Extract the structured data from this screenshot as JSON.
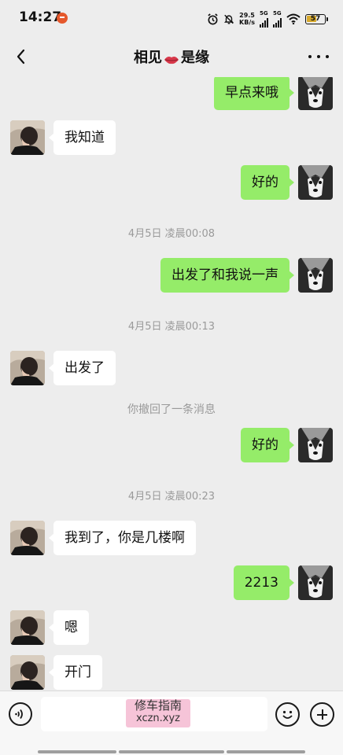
{
  "status_bar": {
    "time": "14:27",
    "net_speed_value": "29.5",
    "net_speed_unit": "KB/s",
    "sim1_label": "5G",
    "sim2_label": "5G",
    "battery_level": "57",
    "notification_icon": "app-notification-icon"
  },
  "header": {
    "title_left": "相见",
    "title_right": "是缘",
    "title_emoji": "lips-icon",
    "back_icon": "chevron-left-icon",
    "more_icon": "more-dots-icon"
  },
  "messages": [
    {
      "sender": "me",
      "text": "早点来哦"
    },
    {
      "sender": "them",
      "text": "我知道"
    },
    {
      "sender": "me",
      "text": "好的"
    },
    {
      "type": "timestamp",
      "text": "4月5日 凌晨00:08"
    },
    {
      "sender": "me",
      "text": "出发了和我说一声"
    },
    {
      "type": "timestamp",
      "text": "4月5日 凌晨00:13"
    },
    {
      "sender": "them",
      "text": "出发了"
    },
    {
      "type": "system",
      "text": "你撤回了一条消息"
    },
    {
      "sender": "me",
      "text": "好的"
    },
    {
      "type": "timestamp",
      "text": "4月5日 凌晨00:23"
    },
    {
      "sender": "them",
      "text": "我到了，你是几楼啊"
    },
    {
      "sender": "me",
      "text": "2213"
    },
    {
      "sender": "them",
      "text": "嗯"
    },
    {
      "sender": "them",
      "text": "开门"
    }
  ],
  "input_bar": {
    "voice_icon": "voice-icon",
    "emoji_icon": "emoji-icon",
    "plus_icon": "plus-icon",
    "watermark_line1": "修车指南",
    "watermark_line2": "xczn.xyz"
  },
  "colors": {
    "background": "#ededed",
    "my_bubble": "#95ec69",
    "their_bubble": "#ffffff",
    "system_text": "#9a9a9a"
  }
}
